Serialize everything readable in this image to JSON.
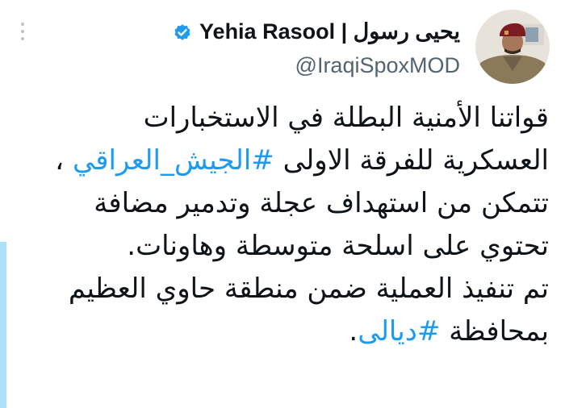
{
  "author": {
    "display_name": "يحيى رسول | Yehia Rasool",
    "handle": "@IraqiSpoxMOD",
    "verified": true
  },
  "icons": {
    "more": "more-vertical-icon",
    "verified": "verified-badge-icon"
  },
  "colors": {
    "hashtag": "#1d9bf0",
    "verified": "#1d9bf0",
    "text": "#0f1419",
    "handle": "#536471"
  },
  "tweet": {
    "line1": "قواتنا الأمنية البطلة في الاستخبارات",
    "line2_pre": "العسكرية للفرقة الاولى ",
    "hashtag_army": "#الجيش_العراقي",
    "line2_post": " ،",
    "line3": "تتمكن من استهداف عجلة وتدمير مضافة",
    "line4": "تحتوي على  اسلحة متوسطة وهاونات.",
    "line5": "تم تنفيذ العملية ضمن منطقة حاوي العظيم",
    "line6_pre": "بمحافظة ",
    "hashtag_diyala": "#ديالى",
    "line6_post": "."
  }
}
